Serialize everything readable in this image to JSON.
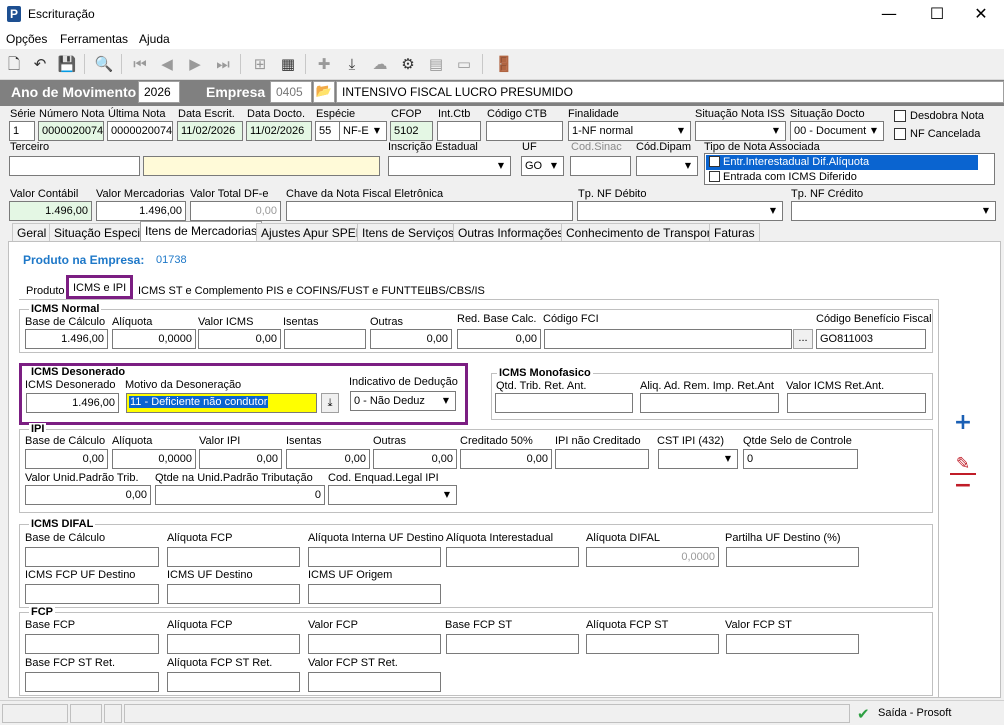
{
  "window": {
    "title": "Escrituração",
    "minimize": "—",
    "maximize": "☐",
    "close": "✕"
  },
  "menu": [
    "Opções",
    "Ferramentas",
    "Ajuda"
  ],
  "header": {
    "ano_label": "Ano de Movimento",
    "ano_value": "2026",
    "empresa_label": "Empresa",
    "empresa_code": "0405",
    "empresa_name": "INTENSIVO FISCAL LUCRO PRESUMIDO"
  },
  "nota": {
    "serie_label": "Série",
    "serie": "1",
    "numero_label": "Número Nota",
    "numero": "0000020074",
    "ultima_label": "Última Nota",
    "ultima": "0000020074",
    "data_escrit_label": "Data Escrit.",
    "data_escrit": "11/02/2026",
    "data_docto_label": "Data Docto.",
    "data_docto": "11/02/2026",
    "especie_label": "Espécie",
    "especie_num": "55",
    "especie": "NF-E",
    "cfop_label": "CFOP",
    "cfop": "5102",
    "intctb_label": "Int.Ctb",
    "intctb": "",
    "codctb_label": "Código CTB",
    "codctb": "",
    "finalidade_label": "Finalidade",
    "finalidade": "1-NF normal",
    "sit_iss_label": "Situação Nota ISS",
    "sit_iss": "",
    "sit_docto_label": "Situação Docto",
    "sit_docto": "00 - Document",
    "desdobra_label": "Desdobra Nota",
    "nf_cancelada_label": "NF Cancelada",
    "terceiro_label": "Terceiro",
    "terceiro": "",
    "terceiro_nome": "",
    "ie_label": "Inscrição Estadual",
    "ie": "",
    "uf_label": "UF",
    "uf": "GO",
    "cod_sinac_label": "Cod.Sinac",
    "cod_sinac": "",
    "cod_dipam_label": "Cód.Dipam",
    "cod_dipam": "",
    "tipo_nota_label": "Tipo de Nota Associada",
    "tipo_nota_items": [
      "Entr.Interestadual Dif.Alíquota",
      "Entrada com ICMS Diferido"
    ],
    "valor_contabil_label": "Valor Contábil",
    "valor_contabil": "1.496,00",
    "valor_merc_label": "Valor Mercadorias",
    "valor_merc": "1.496,00",
    "valor_dfe_label": "Valor Total DF-e",
    "valor_dfe": "0,00",
    "chave_label": "Chave da Nota Fiscal Eletrônica",
    "chave": "",
    "tp_debito_label": "Tp. NF Débito",
    "tp_debito": "",
    "tp_credito_label": "Tp. NF Crédito",
    "tp_credito": ""
  },
  "tabs": [
    "Geral",
    "Situação Especial",
    "Itens de Mercadorias",
    "Ajustes Apur SPED",
    "Itens de Serviços",
    "Outras Informações",
    "Conhecimento de Transporte",
    "Faturas"
  ],
  "produto": {
    "label": "Produto na Empresa:",
    "code": "01738"
  },
  "subtabs": [
    "Produto",
    "ICMS e IPI",
    "ICMS ST e Complemento",
    "PIS e COFINS/FUST e FUNTTEL",
    "IBS/CBS/IS"
  ],
  "icms_normal": {
    "title": "ICMS Normal",
    "base_label": "Base de Cálculo",
    "base": "1.496,00",
    "aliq_label": "Alíquota",
    "aliq": "0,0000",
    "valor_label": "Valor ICMS",
    "valor": "0,00",
    "isentas_label": "Isentas",
    "isentas": "",
    "outras_label": "Outras",
    "outras": "0,00",
    "red_label": "Red. Base Calc.",
    "red": "0,00",
    "fci_label": "Código FCI",
    "fci": "",
    "fci_btn": "...",
    "beneficio_label": "Código Benefício Fiscal",
    "beneficio": "GO811003"
  },
  "icms_deson": {
    "title": "ICMS Desonerado",
    "valor_label": "ICMS Desonerado",
    "valor": "1.496,00",
    "motivo_label": "Motivo da Desoneração",
    "motivo": "11 - Deficiente não condutor",
    "indicativo_label": "Indicativo de Dedução",
    "indicativo": "0 - Não Deduz"
  },
  "icms_mono": {
    "title": "ICMS Monofasico",
    "qtd_label": "Qtd. Trib. Ret. Ant.",
    "aliq_label": "Aliq. Ad. Rem. Imp. Ret.Ant",
    "valor_label": "Valor ICMS Ret.Ant."
  },
  "ipi": {
    "title": "IPI",
    "base_label": "Base de Cálculo",
    "base": "0,00",
    "aliq_label": "Alíquota",
    "aliq": "0,0000",
    "valor_label": "Valor IPI",
    "valor": "0,00",
    "isentas_label": "Isentas",
    "isentas": "0,00",
    "outras_label": "Outras",
    "outras": "0,00",
    "cred50_label": "Creditado 50%",
    "cred50": "0,00",
    "naocred_label": "IPI não Creditado",
    "naocred": "",
    "cst_label": "CST IPI (432)",
    "cst": "",
    "selo_label": "Qtde Selo de Controle",
    "selo": "0",
    "vunid_label": "Valor Unid.Padrão Trib.",
    "vunid": "0,00",
    "qunid_label": "Qtde na Unid.Padrão Tributação",
    "qunid": "0",
    "enquad_label": "Cod. Enquad.Legal IPI",
    "enquad": ""
  },
  "difal": {
    "title": "ICMS DIFAL",
    "base_label": "Base de Cálculo",
    "aliq_fcp_label": "Alíquota FCP",
    "aliq_int_label": "Alíquota Interna UF Destino",
    "aliq_inter_label": "Alíquota Interestadual",
    "aliq_difal_label": "Alíquota DIFAL",
    "aliq_difal": "0,0000",
    "partilha_label": "Partilha UF Destino (%)",
    "fcp_dest_label": "ICMS FCP UF Destino",
    "uf_dest_label": "ICMS UF Destino",
    "uf_orig_label": "ICMS UF Origem"
  },
  "fcp": {
    "title": "FCP",
    "base_label": "Base FCP",
    "aliq_label": "Alíquota FCP",
    "valor_label": "Valor FCP",
    "base_st_label": "Base FCP ST",
    "aliq_st_label": "Alíquota FCP ST",
    "valor_st_label": "Valor FCP ST",
    "base_ret_label": "Base FCP ST Ret.",
    "aliq_ret_label": "Alíquota FCP ST Ret.",
    "valor_ret_label": "Valor FCP ST Ret."
  },
  "side": {
    "add": "+",
    "edit": "✎",
    "remove": "−"
  },
  "statusbar": {
    "text": "Saída - Prosoft",
    "check": "✔"
  }
}
